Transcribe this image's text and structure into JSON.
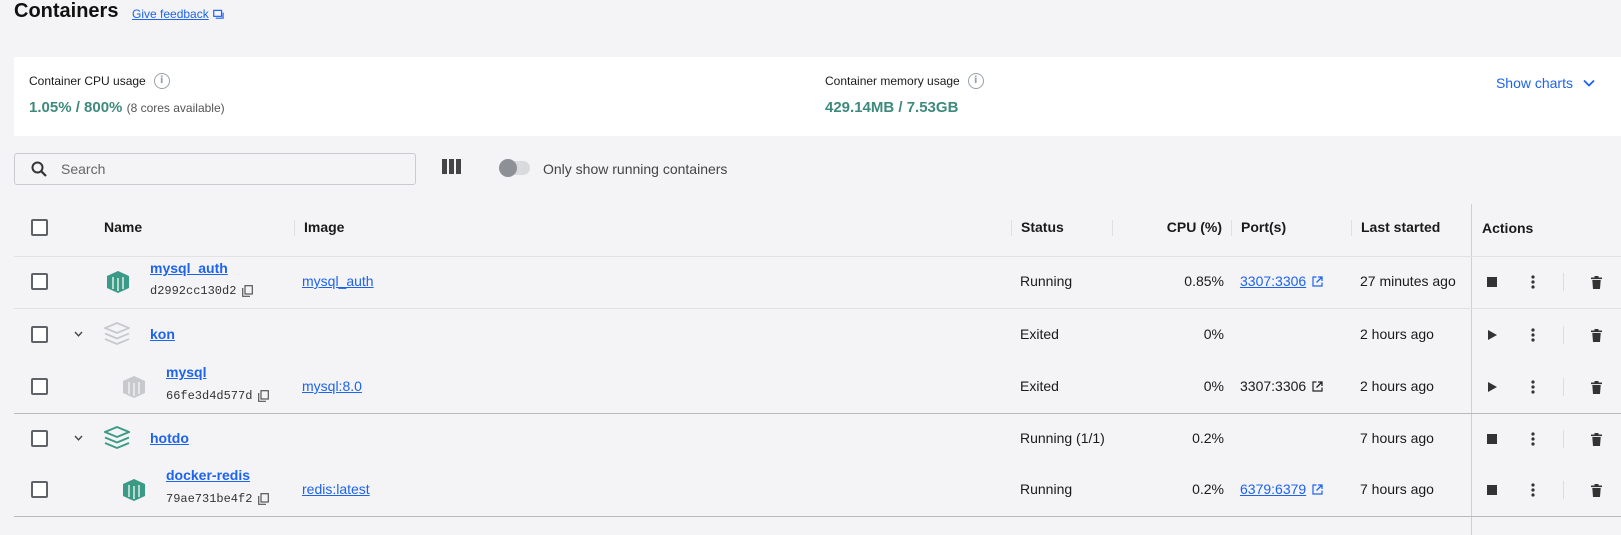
{
  "page": {
    "title": "Containers",
    "feedback_label": "Give feedback"
  },
  "usage": {
    "cpu_label": "Container CPU usage",
    "cpu_value": "1.05% / 800%",
    "cpu_suffix": "(8 cores available)",
    "memory_label": "Container memory usage",
    "memory_value": "429.14MB / 7.53GB",
    "show_charts_label": "Show charts"
  },
  "toolbar": {
    "search_placeholder": "Search",
    "toggle_label": "Only show running containers",
    "toggle_on": false
  },
  "table": {
    "headers": {
      "name": "Name",
      "image": "Image",
      "status": "Status",
      "cpu": "CPU (%)",
      "ports": "Port(s)",
      "last_started": "Last started",
      "actions": "Actions"
    },
    "rows": [
      {
        "name": "mysql_auth",
        "id": "d2992cc130d2",
        "image": "mysql_auth",
        "status": "Running",
        "cpu": "0.85%",
        "port": "3307:3306",
        "last_started": "27 minutes ago",
        "icon": "container-running-icon",
        "primary_action": "stop"
      },
      {
        "name": "kon",
        "id": "",
        "image": "",
        "status": "Exited",
        "cpu": "0%",
        "port": "",
        "last_started": "2 hours ago",
        "icon": "compose-stack-stopped-icon",
        "primary_action": "start"
      },
      {
        "name": "mysql",
        "id": "66fe3d4d577d",
        "image": "mysql:8.0",
        "status": "Exited",
        "cpu": "0%",
        "port": "3307:3306",
        "last_started": "2 hours ago",
        "icon": "container-stopped-icon",
        "primary_action": "start"
      },
      {
        "name": "hotdo",
        "id": "",
        "image": "",
        "status": "Running (1/1)",
        "cpu": "0.2%",
        "port": "",
        "last_started": "7 hours ago",
        "icon": "compose-stack-running-icon",
        "primary_action": "stop"
      },
      {
        "name": "docker-redis",
        "id": "79ae731be4f2",
        "image": "redis:latest",
        "status": "Running",
        "cpu": "0.2%",
        "port": "6379:6379",
        "last_started": "7 hours ago",
        "icon": "container-running-icon",
        "primary_action": "stop"
      }
    ]
  },
  "colors": {
    "accent": "#1d63ed",
    "usage_value": "#3e8a7e",
    "running_icon": "#3a9a86",
    "stopped_icon": "#c7c9cc"
  }
}
